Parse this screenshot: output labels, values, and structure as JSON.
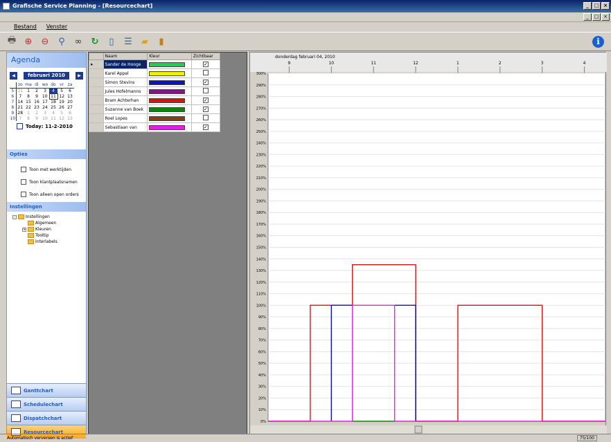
{
  "window": {
    "title": "Grafische Service Planning - [Resourcechart]"
  },
  "menu": [
    "Bestand",
    "Venster"
  ],
  "toolbar": {
    "icons": [
      "print-icon",
      "zoom-in-icon",
      "zoom-out-icon",
      "zoom-icon",
      "binoculars-icon",
      "refresh-icon",
      "page-icon",
      "list-icon",
      "folder-icon",
      "battery-icon"
    ],
    "info_icon": "info-icon"
  },
  "agenda": {
    "title": "Agenda",
    "month": "februari 2010",
    "weekdays": [
      "zo",
      "ma",
      "di",
      "wo",
      "do",
      "vr",
      "za"
    ],
    "weeks": [
      {
        "wk": "5",
        "days": [
          "31",
          "1",
          "2",
          "3",
          "4",
          "5",
          "6"
        ]
      },
      {
        "wk": "6",
        "days": [
          "7",
          "8",
          "9",
          "10",
          "11",
          "12",
          "13"
        ]
      },
      {
        "wk": "7",
        "days": [
          "14",
          "15",
          "16",
          "17",
          "18",
          "19",
          "20"
        ]
      },
      {
        "wk": "8",
        "days": [
          "21",
          "22",
          "23",
          "24",
          "25",
          "26",
          "27"
        ]
      },
      {
        "wk": "9",
        "days": [
          "28",
          "1",
          "2",
          "3",
          "4",
          "5",
          "6"
        ]
      },
      {
        "wk": "10",
        "days": [
          "7",
          "8",
          "9",
          "10",
          "11",
          "12",
          "13"
        ]
      }
    ],
    "selected_day": "4",
    "today_day": "11",
    "today_label": "Today: 11-2-2010"
  },
  "options": {
    "title": "Opties",
    "items": [
      "Toon met werktijden",
      "Toon klantplaatsnamen",
      "Toon alleen open orders"
    ]
  },
  "settings": {
    "title": "Instellingen",
    "tree": [
      {
        "label": "Instellingen",
        "level": 0,
        "expander": "-"
      },
      {
        "label": "Algemeen",
        "level": 1,
        "expander": ""
      },
      {
        "label": "Kleuren",
        "level": 1,
        "expander": "+"
      },
      {
        "label": "Tooltip",
        "level": 1,
        "expander": ""
      },
      {
        "label": "Interlabels",
        "level": 1,
        "expander": ""
      }
    ]
  },
  "nav": [
    {
      "label": "Ganttchart",
      "active": false
    },
    {
      "label": "Schedulechart",
      "active": false
    },
    {
      "label": "Dispatchchart",
      "active": false
    },
    {
      "label": "Resourcechart",
      "active": true
    }
  ],
  "grid": {
    "headers": [
      "Naam",
      "Kleur",
      "Zichtbaar"
    ],
    "rows": [
      {
        "name": "Sander de Hooge",
        "color": "#22cc55",
        "visible": true
      },
      {
        "name": "Karel Appel",
        "color": "#f0f000",
        "visible": false
      },
      {
        "name": "Simon Stevins",
        "color": "#1010c0",
        "visible": true
      },
      {
        "name": "Jules Hofelmanns",
        "color": "#7a1a7a",
        "visible": false
      },
      {
        "name": "Bram Achterhan",
        "color": "#e01010",
        "visible": true
      },
      {
        "name": "Suzanne van Boek",
        "color": "#108010",
        "visible": true
      },
      {
        "name": "Roel Lopes",
        "color": "#804010",
        "visible": false
      },
      {
        "name": "Sebastiaan van",
        "color": "#e020e0",
        "visible": true
      }
    ]
  },
  "chart_data": {
    "type": "line",
    "title": "donderdag februari 04, 2010",
    "x_ticks": [
      "9",
      "10",
      "11",
      "12",
      "1",
      "2",
      "3",
      "4"
    ],
    "x_range": [
      8.5,
      16.5
    ],
    "y_ticks": [
      "0%",
      "10%",
      "20%",
      "30%",
      "40%",
      "50%",
      "60%",
      "70%",
      "80%",
      "90%",
      "100%",
      "110%",
      "120%",
      "130%",
      "140%",
      "150%",
      "160%",
      "170%",
      "180%",
      "190%",
      "200%",
      "210%",
      "220%",
      "230%",
      "240%",
      "250%",
      "260%",
      "270%",
      "280%",
      "290%",
      "300%"
    ],
    "ylim": [
      0,
      300
    ],
    "grid": true,
    "series": [
      {
        "color": "#e01010",
        "points": [
          [
            8.5,
            0
          ],
          [
            9.5,
            0
          ],
          [
            9.5,
            100
          ],
          [
            10.5,
            100
          ],
          [
            10.5,
            135
          ],
          [
            12,
            135
          ],
          [
            12,
            0
          ],
          [
            13,
            0
          ],
          [
            13,
            100
          ],
          [
            15,
            100
          ],
          [
            15,
            0
          ],
          [
            16.5,
            0
          ]
        ]
      },
      {
        "color": "#1010c0",
        "points": [
          [
            10,
            0
          ],
          [
            10,
            100
          ],
          [
            10.5,
            100
          ]
        ]
      },
      {
        "color": "#1010c0",
        "points": [
          [
            11.5,
            100
          ],
          [
            12,
            100
          ],
          [
            12,
            0
          ]
        ]
      },
      {
        "color": "#108010",
        "points": [
          [
            10.5,
            0
          ],
          [
            11.5,
            0
          ]
        ]
      },
      {
        "color": "#e020e0",
        "points": [
          [
            8.5,
            0
          ],
          [
            10.5,
            0
          ],
          [
            10.5,
            100
          ],
          [
            11.5,
            100
          ],
          [
            11.5,
            0
          ],
          [
            16.5,
            0
          ]
        ]
      }
    ]
  },
  "status": {
    "text": "Automatisch verversen is actief",
    "zoom": "75/100"
  }
}
